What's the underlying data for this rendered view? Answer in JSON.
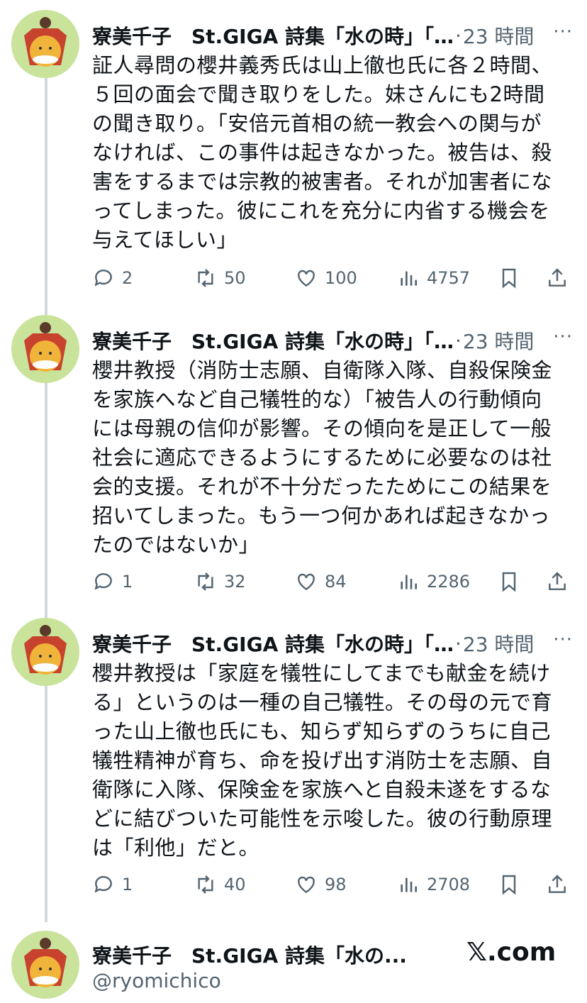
{
  "tweets": [
    {
      "name": "寮美千子　St.GIGA 詩集「水の時」「...",
      "time": "23 時間",
      "more": "···",
      "text": "証人尋問の櫻井義秀氏は山上徹也氏に各２時間、\n５回の面会で聞き取りをした。妹さんにも2時間\nの聞き取り。「安倍元首相の統一教会への関与が\nなければ、この事件は起きなかった。被告は、殺\n害をするまでは宗教的被害者。それが加害者にな\nってしまった。彼にこれを充分に内省する機会を\n与えてほしい」",
      "replies": "2",
      "reposts": "50",
      "likes": "100",
      "views": "4757"
    },
    {
      "name": "寮美千子　St.GIGA 詩集「水の時」「...",
      "time": "23 時間",
      "more": "···",
      "text": "櫻井教授（消防士志願、自衛隊入隊、自殺保険金\nを家族へなど自己犠牲的な）「被告人の行動傾向\nには母親の信仰が影響。その傾向を是正して一般\n社会に適応できるようにするために必要なのは社\n会的支援。それが不十分だったためにこの結果を\n招いてしまった。もう一つ何かあれば起きなかっ\nたのではないか」",
      "replies": "1",
      "reposts": "32",
      "likes": "84",
      "views": "2286"
    },
    {
      "name": "寮美千子　St.GIGA 詩集「水の時」「...",
      "time": "23 時間",
      "more": "···",
      "text": "櫻井教授は「家庭を犠牲にしてまでも献金を続け\nる」というのは一種の自己犠牲。その母の元で育\nった山上徹也氏にも、知らず知らずのうちに自己\n犠牲精神が育ち、命を投げ出す消防士を志願、自\n衛隊に入隊、保険金を家族へと自殺未遂をするな\nどに結びついた可能性を示唆した。彼の行動原理\nは「利他」だと。",
      "replies": "1",
      "reposts": "40",
      "likes": "98",
      "views": "2708"
    }
  ],
  "profile": {
    "name": "寮美千子　St.GIGA 詩集「水の...",
    "handle": "@ryomichico",
    "site": "𝕏.com"
  },
  "icons": [
    "reply-icon",
    "repost-icon",
    "like-icon",
    "views-icon",
    "bookmark-icon",
    "share-icon"
  ],
  "colors": {
    "secondary": "#536471",
    "thread_line": "#cfd9de",
    "avatar_bg": "#c9e39a"
  }
}
